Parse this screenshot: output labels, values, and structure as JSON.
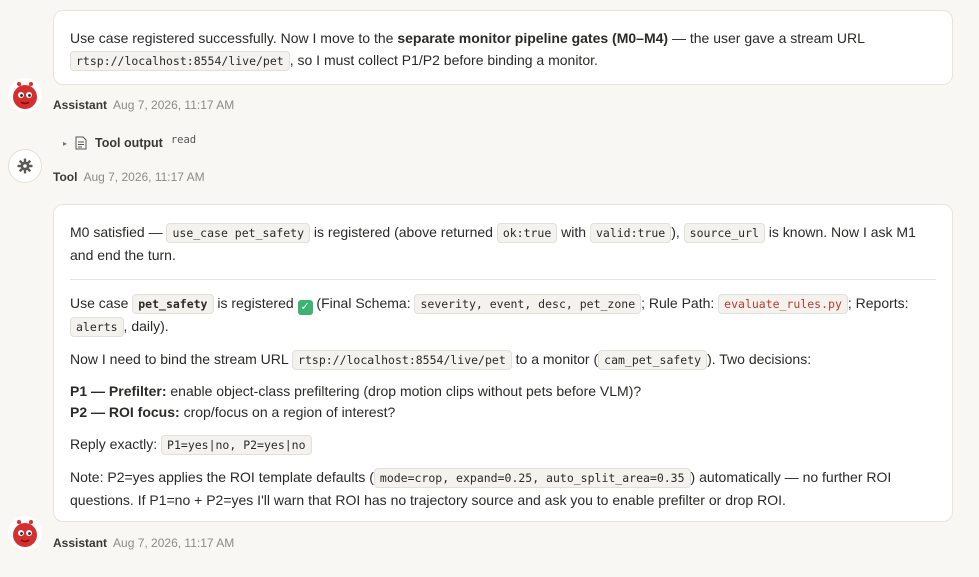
{
  "msg1": {
    "part_a": "Use case registered successfully. Now I move to the ",
    "bold": "separate monitor pipeline gates (M0–M4)",
    "part_b": " — the user gave a stream URL",
    "code_url": "rtsp://localhost:8554/live/pet",
    "part_c": ", so I must collect P1/P2 before binding a monitor."
  },
  "meta1": {
    "who": "Assistant",
    "time": "Aug 7, 2026, 11:17 AM"
  },
  "tool": {
    "label": "Tool output",
    "tag": "read"
  },
  "meta2": {
    "who": "Tool",
    "time": "Aug 7, 2026, 11:17 AM"
  },
  "msg2": {
    "p1_a": "M0 satisfied — ",
    "p1_code1": "use_case pet_safety",
    "p1_b": " is registered (above returned ",
    "p1_code2": "ok:true",
    "p1_c": " with ",
    "p1_code3": "valid:true",
    "p1_d": "), ",
    "p1_code4": "source_url",
    "p1_e": " is known. Now I ask M1 and end the turn.",
    "p2_a": "Use case ",
    "p2_code1": "pet_safety",
    "p2_b": " is registered ",
    "p2_check": "✓",
    "p2_c": " (Final Schema: ",
    "p2_code2": "severity, event, desc, pet_zone",
    "p2_d": "; Rule Path: ",
    "p2_code3": "evaluate_rules.py",
    "p2_e": "; Reports: ",
    "p2_code4": "alerts",
    "p2_f": ", daily).",
    "p3_a": "Now I need to bind the stream URL ",
    "p3_code1": "rtsp://localhost:8554/live/pet",
    "p3_b": " to a monitor (",
    "p3_code2": "cam_pet_safety",
    "p3_c": "). Two decisions:",
    "p4_bold1": "P1 — Prefilter:",
    "p4_t1": " enable object-class prefiltering (drop motion clips without pets before VLM)?",
    "p4_bold2": "P2 — ROI focus:",
    "p4_t2": " crop/focus on a region of interest?",
    "p5_a": "Reply exactly: ",
    "p5_code": "P1=yes|no, P2=yes|no",
    "p6_a": "Note: P2=yes applies the ROI template defaults (",
    "p6_code": "mode=crop, expand=0.25, auto_split_area=0.35",
    "p6_b": ") automatically — no further ROI questions. If P1=no + P2=yes I'll warn that ROI has no trajectory source and ask you to enable prefilter or drop ROI."
  },
  "meta3": {
    "who": "Assistant",
    "time": "Aug 7, 2026, 11:17 AM"
  },
  "colors": {
    "background": "#f8f7f4",
    "bubble": "#ffffff",
    "code_red": "#c0392b",
    "check_green": "#3cb371"
  }
}
